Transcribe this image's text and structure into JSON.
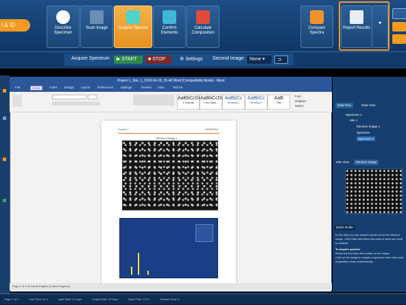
{
  "top": {
    "specimen_tab": "t & ID",
    "buttons": [
      {
        "label": "Describe Specimen",
        "color": "#ffffff"
      },
      {
        "label": "Scan Image",
        "color": "#9fb7d0"
      },
      {
        "label": "Acquire Spectra",
        "color": "#4fd3c8"
      },
      {
        "label": "Confirm Elements",
        "color": "#3fb8d8"
      },
      {
        "label": "Calculate Composition",
        "color": "#e24a3a"
      },
      {
        "label": "Compare Spectra",
        "color": "#f2922b"
      },
      {
        "label": "Report Results",
        "color": "#e8eef5"
      }
    ]
  },
  "strip": {
    "acquire_label": "Acquire Spectrum",
    "start": "START",
    "stop": "STOP",
    "settings": "Settings",
    "second_image_label": "Second Image:",
    "second_image_value": "None"
  },
  "word": {
    "title": "Project 1_Site_1_2016-04-18_15-48 Word [Compatibility Mode] - Word",
    "tabs": [
      "File",
      "Home",
      "Insert",
      "Design",
      "Layout",
      "References",
      "Mailings",
      "Review",
      "View",
      "Tell me"
    ],
    "styles": [
      {
        "sample": "AaBbCcDd",
        "name": "1 Normal"
      },
      {
        "sample": "AaBbCcDd",
        "name": "1 No Spac..."
      },
      {
        "sample": "AaBbCc",
        "name": "Heading 1"
      },
      {
        "sample": "AaBbCc",
        "name": "Heading 2"
      },
      {
        "sample": "AaB",
        "name": "Title"
      }
    ],
    "editing": [
      "Find",
      "Replace",
      "Select"
    ],
    "doc_header_left": "Project 1",
    "doc_header_right": "13/05/2016",
    "image_caption": "Electron Image 1",
    "status": "Page 1 of 1   53 words   English (United Kingdom)"
  },
  "panel": {
    "tabs": [
      "Data Tree",
      "Data View"
    ],
    "tree": [
      "Specimen 1",
      "Site 1",
      "Electron Image 1",
      "Spectrum",
      "Spectrum 2"
    ],
    "image_tabs": [
      "Mini View",
      "Electron Image"
    ],
    "help_title": "Quick Guide",
    "help_text": "In this step you can acquire spectra from the electron image. Click Start and select the point or area you want to analyse.",
    "help_heading": "To acquire spectra:",
    "bullets": [
      "Select the tool from the toolbar on the image.",
      "Click on the image to acquire a spectrum from that point.",
      "Acquisition stops automatically."
    ]
  },
  "bottom": [
    "Page: 1 of 1",
    "Live Time: 10 s",
    "Input Rate: 12 kcps",
    "Output Rate: 10 kcps",
    "Dead Time: 15 %",
    "Process Time: 5"
  ]
}
